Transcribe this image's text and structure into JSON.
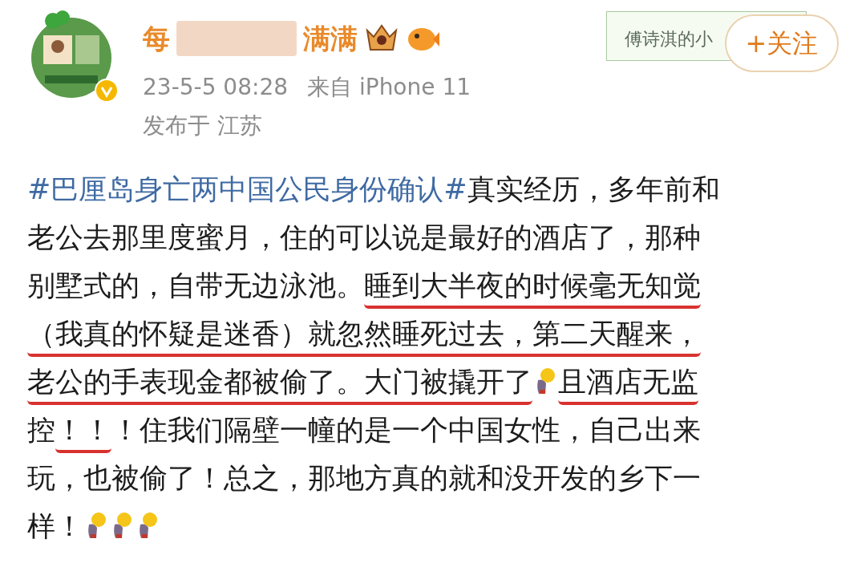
{
  "user": {
    "name_start": "每",
    "name_end": "满满",
    "verified": true,
    "timestamp": "23-5-5 08:28",
    "source": "来自 iPhone 11",
    "location": "发布于 江苏"
  },
  "badge_card": {
    "text": "傅诗淇的小"
  },
  "follow_button": {
    "label": "+关注"
  },
  "post": {
    "lines": [
      {
        "segments": [
          {
            "kind": "hashtag",
            "text": "#巴厘岛身亡两中国公民身份确认#",
            "underlined": false
          },
          {
            "kind": "text",
            "text": "真实经历，多年前和",
            "underlined": false
          }
        ]
      },
      {
        "segments": [
          {
            "kind": "text",
            "text": "老公去那里度蜜月，住的可以说是最好的酒店了，那种",
            "underlined": false
          }
        ]
      },
      {
        "segments": [
          {
            "kind": "text",
            "text": "别墅式的，自带无边泳池。",
            "underlined": false
          },
          {
            "kind": "text",
            "text": "睡到大半夜的时候毫无知觉",
            "underlined": true
          }
        ]
      },
      {
        "segments": [
          {
            "kind": "text",
            "text": "（我真的怀疑是迷香）就忽然睡死过去，第二天醒来，",
            "underlined": true
          }
        ]
      },
      {
        "segments": [
          {
            "kind": "text",
            "text": "老公的手表现金都被偷了。大门被撬开了",
            "underlined": true
          },
          {
            "kind": "emoji"
          },
          {
            "kind": "text",
            "text": "且酒店无监",
            "underlined": true
          }
        ]
      },
      {
        "segments": [
          {
            "kind": "text",
            "text": "控",
            "underlined": false
          },
          {
            "kind": "text",
            "text": "！！",
            "underlined": true
          },
          {
            "kind": "text",
            "text": "！住我们隔壁一幢的是一个中国女性，自己出来",
            "underlined": false
          }
        ]
      },
      {
        "segments": [
          {
            "kind": "text",
            "text": "玩，也被偷了！总之，那地方真的就和没开发的乡下一",
            "underlined": false
          }
        ]
      },
      {
        "segments": [
          {
            "kind": "text",
            "text": "样！",
            "underlined": false
          },
          {
            "kind": "emoji"
          },
          {
            "kind": "emoji"
          },
          {
            "kind": "emoji"
          }
        ]
      }
    ]
  }
}
